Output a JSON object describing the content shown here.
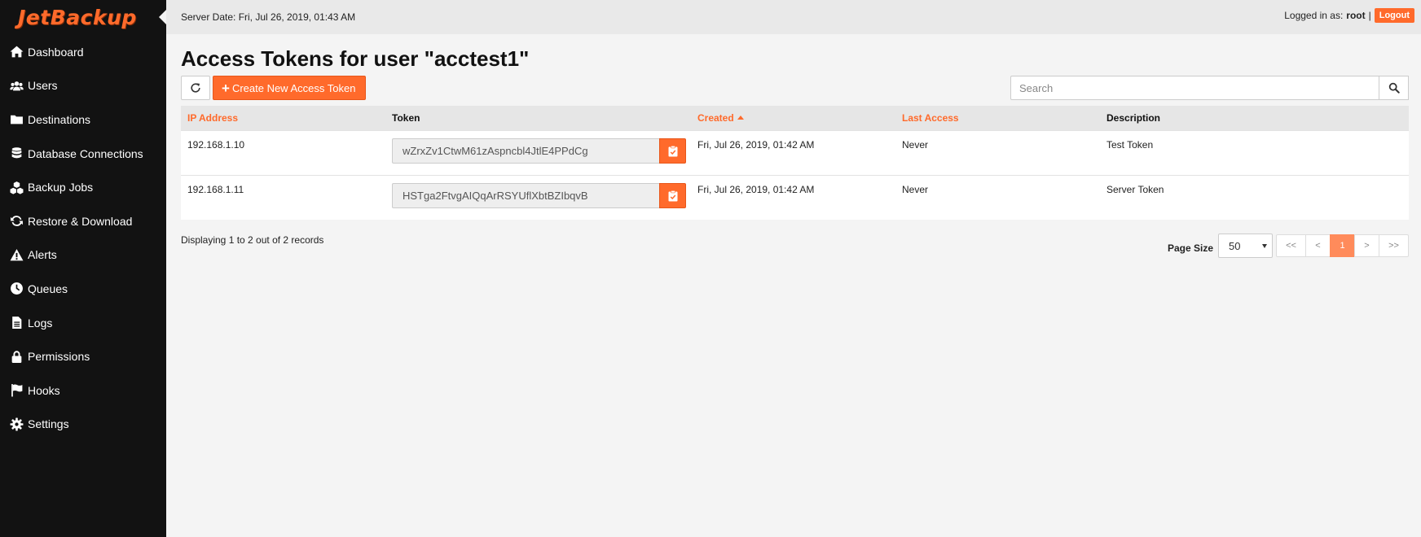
{
  "app": {
    "logo_text": "JetBackup"
  },
  "topbar": {
    "server_date": "Server Date: Fri, Jul 26, 2019, 01:43 AM",
    "logged_in_label": "Logged in as:",
    "username": "root",
    "separator": "|",
    "logout_label": "Logout"
  },
  "sidebar": {
    "items": [
      {
        "label": "Dashboard",
        "icon": "home-icon"
      },
      {
        "label": "Users",
        "icon": "users-icon"
      },
      {
        "label": "Destinations",
        "icon": "folder-icon"
      },
      {
        "label": "Database Connections",
        "icon": "database-icon"
      },
      {
        "label": "Backup Jobs",
        "icon": "cubes-icon"
      },
      {
        "label": "Restore & Download",
        "icon": "refresh-icon"
      },
      {
        "label": "Alerts",
        "icon": "warning-icon"
      },
      {
        "label": "Queues",
        "icon": "clock-icon"
      },
      {
        "label": "Logs",
        "icon": "file-icon"
      },
      {
        "label": "Permissions",
        "icon": "lock-icon"
      },
      {
        "label": "Hooks",
        "icon": "flag-icon"
      },
      {
        "label": "Settings",
        "icon": "gear-icon"
      }
    ]
  },
  "main": {
    "title": "Access Tokens for user \"acctest1\"",
    "create_button_label": "Create New Access Token",
    "search_placeholder": "Search",
    "table": {
      "columns": [
        "IP Address",
        "Token",
        "Created",
        "Last Access",
        "Description"
      ],
      "rows": [
        {
          "ip": "192.168.1.10",
          "token": "wZrxZv1CtwM61zAspncbl4JtlE4PPdCg",
          "created": "Fri, Jul 26, 2019, 01:42 AM",
          "last_access": "Never",
          "description": "Test Token"
        },
        {
          "ip": "192.168.1.11",
          "token": "HSTga2FtvgAIQqArRSYUflXbtBZIbqvB",
          "created": "Fri, Jul 26, 2019, 01:42 AM",
          "last_access": "Never",
          "description": "Server Token"
        }
      ]
    },
    "records_text": "Displaying 1 to 2 out of 2 records",
    "pagination": {
      "page_size_label": "Page Size",
      "page_size_value": "50",
      "first": "<<",
      "prev": "<",
      "current": "1",
      "next": ">",
      "last": ">>"
    }
  },
  "colors": {
    "accent": "#ff6a2b",
    "sidebar_bg": "#121212",
    "topbar_bg": "#e9e9e9"
  }
}
